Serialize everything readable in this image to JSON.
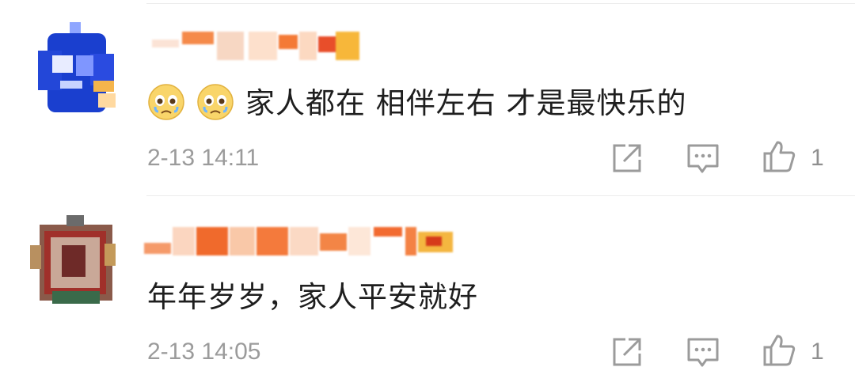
{
  "comments": [
    {
      "username": "",
      "text": "家人都在 相伴左右 才是最快乐的",
      "emoji_icons": [
        "crying-face-icon",
        "crying-face-icon"
      ],
      "time": "2-13 14:11",
      "like_count": "1"
    },
    {
      "username": "",
      "text": "年年岁岁，家人平安就好",
      "emoji_icons": [],
      "time": "2-13 14:05",
      "like_count": "1"
    }
  ],
  "actions": {
    "share_icon": "share-icon",
    "reply_icon": "reply-icon",
    "like_icon": "thumbs-up-icon"
  },
  "colors": {
    "text": "#1e1e1e",
    "meta": "#9b9b9b",
    "divider": "#ececec",
    "name_blur": "#f08030"
  }
}
